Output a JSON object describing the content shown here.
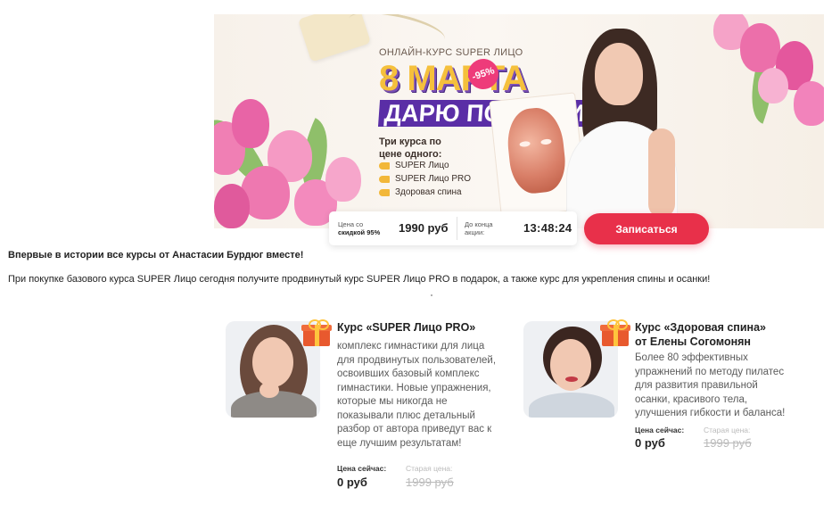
{
  "banner": {
    "kicker": "ОНЛАЙН-КУРС SUPER ЛИЦО",
    "title_line1": "8 МАРТА",
    "title_line2": "ДАРЮ ПОДАРКИ",
    "discount_badge": "-95%",
    "offer_heading": "Три курса по цене одного:",
    "courses": [
      "SUPER Лицо",
      "SUPER Лицо PRO",
      "Здоровая спина"
    ]
  },
  "price_bar": {
    "price_label_1": "Цена со",
    "price_label_2": "скидкой 95%",
    "price_value": "1990 руб",
    "timer_label_1": "До конца",
    "timer_label_2": "акции:",
    "timer_value": "13:48:24",
    "signup_label": "Записаться"
  },
  "headline": "Впервые в истории все курсы от Анастасии Бурдюг вместе!",
  "lead": "При покупке базового курса SUPER Лицо сегодня получите продвинутый курс SUPER Лицо PRO в подарок, а также курс для укрепления спины и осанки!",
  "cards": [
    {
      "title": "Курс «SUPER Лицо PRO»",
      "description": "комплекс гимнастики для лица для продвинутых пользователей, освоивших базовый комплекс гимнастики. Новые упражнения, которые мы никогда не показывали плюс детальный разбор от автора приведут вас к еще лучшим результатам!",
      "price_now_label": "Цена сейчас:",
      "price_old_label": "Старая цена:",
      "price_now": "0 руб",
      "price_old": "1999 руб"
    },
    {
      "title_line1": "Курс «Здоровая спина»",
      "title_line2": "от Елены Согомонян",
      "description": "Более 80 эффективных упражнений по методу пилатес для развития правильной осанки, красивого тела, улучшения гибкости и баланса!",
      "price_now_label": "Цена сейчас:",
      "price_old_label": "Старая цена:",
      "price_now": "0 руб",
      "price_old": "1999 руб"
    }
  ],
  "colors": {
    "accent_red": "#e8304a",
    "title_yellow": "#f5c03c",
    "title_purple": "#5a2ea6",
    "badge_pink": "#ee3b7a"
  }
}
